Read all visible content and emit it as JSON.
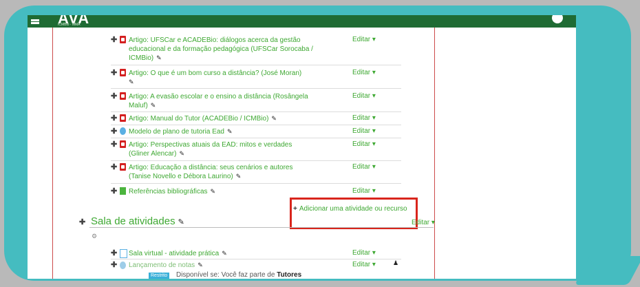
{
  "header": {
    "logo": "AVA",
    "logo_sub": "ICMBio · MMA"
  },
  "section1": {
    "items": [
      {
        "icon": "pdf-icon",
        "lines": [
          "Artigo: UFSCar e ACADEBio: diálogos acerca da gestão",
          "educacional e da formação pedagógica (UFSCar Sorocaba /",
          "ICMBio)"
        ],
        "edit": "Editar ▾"
      },
      {
        "icon": "pdf-icon",
        "lines": [
          "Artigo: O que é um bom curso a distância? (José Moran)"
        ],
        "edit": "Editar ▾"
      },
      {
        "icon": "pdf-icon",
        "lines": [
          "Artigo: A evasão escolar e o ensino a distância (Rosângela",
          "Maluf)"
        ],
        "edit": "Editar ▾"
      },
      {
        "icon": "pdf-icon",
        "lines": [
          "Artigo: Manual do Tutor (ACADEBio / ICMBio)"
        ],
        "edit": "Editar ▾"
      },
      {
        "icon": "url-icon",
        "lines": [
          "Modelo de plano de tutoria Ead"
        ],
        "edit": "Editar ▾"
      },
      {
        "icon": "pdf-icon",
        "lines": [
          "Artigo: Perspectivas atuais da EAD: mitos e verdades",
          "(Gliner Alencar)"
        ],
        "edit": "Editar ▾"
      },
      {
        "icon": "pdf-icon",
        "lines": [
          "Artigo: Educação a distância: seus cenários e autores",
          "(Tanise Novello e Débora Laurino)"
        ],
        "edit": "Editar ▾"
      },
      {
        "icon": "book-icon",
        "lines": [
          "Referências bibliográficas"
        ],
        "edit": "Editar ▾"
      }
    ],
    "add_activity": "Adicionar uma atividade ou recurso"
  },
  "section2": {
    "title": "Sala de atividades",
    "edit": "Editar ▾",
    "items": [
      {
        "icon": "page-icon",
        "label": "Sala virtual - atividade prática",
        "edit": "Editar ▾"
      },
      {
        "icon": "cloud-icon",
        "label": "Lançamento de notas",
        "edit": "Editar ▾"
      }
    ],
    "restriction_badge": "Restrito",
    "restriction_text": "Disponível se: Você faz parte de ",
    "restriction_group": "Tutores"
  }
}
